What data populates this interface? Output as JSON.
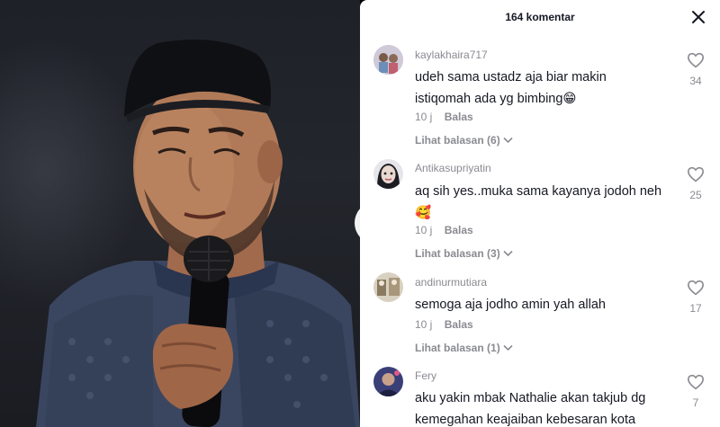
{
  "panel": {
    "title": "164 komentar"
  },
  "comments": [
    {
      "username": "kaylakhaira717",
      "text_line1": "udeh sama ustadz aja biar makin",
      "text_line2": "istiqomah ada yg bimbing😁",
      "time": "10 j",
      "reply_label": "Balas",
      "view_replies": "Lihat balasan (6)",
      "likes": "34"
    },
    {
      "username": "Antikasupriyatin",
      "text_line1": "aq sih yes..muka sama kayanya jodoh neh",
      "text_line2": "🥰",
      "time": "10 j",
      "reply_label": "Balas",
      "view_replies": "Lihat balasan (3)",
      "likes": "25"
    },
    {
      "username": "andinurmutiara",
      "text_line1": "semoga aja jodho amin yah allah",
      "time": "10 j",
      "reply_label": "Balas",
      "view_replies": "Lihat balasan (1)",
      "likes": "17"
    },
    {
      "username": "Fery",
      "text_line1": "aku yakin mbak Nathalie akan takjub dg",
      "text_line2": "kemegahan keajaiban kebesaran kota",
      "likes": "7"
    }
  ],
  "icons": {
    "close": "close-icon",
    "heart": "heart-outline-icon",
    "chevron": "chevron-down-icon"
  },
  "colors": {
    "text_primary": "#161823",
    "text_secondary": "#8a8b91",
    "panel_bg": "#ffffff"
  }
}
